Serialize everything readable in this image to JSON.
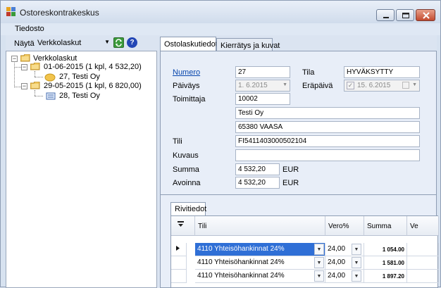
{
  "window": {
    "title": "Ostoreskontrakeskus"
  },
  "menu": {
    "items": [
      {
        "label": "Tiedosto"
      }
    ]
  },
  "toolbar": {
    "show_label": "Näytä",
    "view_value": "Verkkolaskut"
  },
  "tree": {
    "root": "Verkkolaskut",
    "groups": [
      {
        "label": "01-06-2015 (1 kpl, 4 532,20)",
        "child": "27, Testi Oy"
      },
      {
        "label": "29-05-2015 (1 kpl, 6 820,00)",
        "child": "28, Testi Oy"
      }
    ]
  },
  "tabs": [
    {
      "label": "Ostolaskutiedot"
    },
    {
      "label": "Kierrätys ja kuvat"
    }
  ],
  "details": {
    "numero_label": "Numero",
    "numero_value": "27",
    "tila_label": "Tila",
    "tila_value": "HYVÄKSYTTY",
    "paivays_label": "Päiväys",
    "paivays_value": "1.  6.2015",
    "erapaiva_label": "Eräpäivä",
    "erapaiva_value": "15.  6.2015",
    "toimittaja_label": "Toimittaja",
    "toimittaja_id": "10002",
    "supplier_name": "Testi Oy",
    "supplier_city": "65380 VAASA",
    "tili_label": "Tili",
    "tili_value": "FI5411403000502104",
    "kuvaus_label": "Kuvaus",
    "kuvaus_value": "",
    "summa_label": "Summa",
    "summa_value": "4 532,20",
    "summa_currency": "EUR",
    "avoinna_label": "Avoinna",
    "avoinna_value": "4 532,20",
    "avoinna_currency": "EUR"
  },
  "rows": {
    "tab_label": "Rivitiedot",
    "columns": [
      "Tili",
      "Vero%",
      "Summa",
      "Ve"
    ],
    "items": [
      {
        "account": "4110 Yhteisöhankinnat 24%",
        "vat": "24,00",
        "amount": "1 054.00"
      },
      {
        "account": "4110 Yhteisöhankinnat 24%",
        "vat": "24,00",
        "amount": "1 581.00"
      },
      {
        "account": "4110 Yhteisöhankinnat 24%",
        "vat": "24,00",
        "amount": "1 897.20"
      }
    ]
  }
}
